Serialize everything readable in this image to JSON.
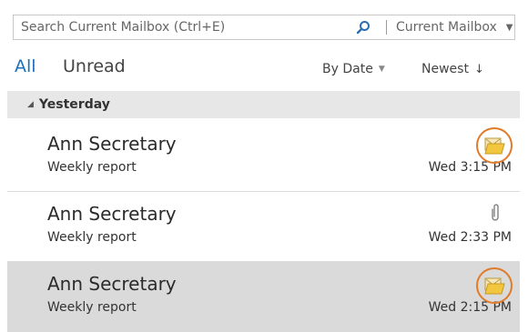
{
  "search": {
    "placeholder": "Search Current Mailbox (Ctrl+E)",
    "scope": "Current Mailbox",
    "icon": "search-icon"
  },
  "filters": {
    "all_label": "All",
    "unread_label": "Unread",
    "sort_by": "By Date",
    "sort_order": "Newest",
    "accent": "#1e6fbf"
  },
  "group": {
    "label": "Yesterday"
  },
  "messages": [
    {
      "sender": "Ann Secretary",
      "subject": "Weekly report",
      "time": "Wed 3:15 PM",
      "icon": "shared-folder-icon",
      "selected": false
    },
    {
      "sender": "Ann Secretary",
      "subject": "Weekly report",
      "time": "Wed 2:33 PM",
      "icon": "paperclip-icon",
      "selected": false
    },
    {
      "sender": "Ann Secretary",
      "subject": "Weekly report",
      "time": "Wed 2:15 PM",
      "icon": "shared-folder-icon",
      "selected": true
    }
  ],
  "colors": {
    "highlight_ring": "#e07b2a",
    "selected_row": "#dadada",
    "group_header": "#e7e7e7"
  }
}
